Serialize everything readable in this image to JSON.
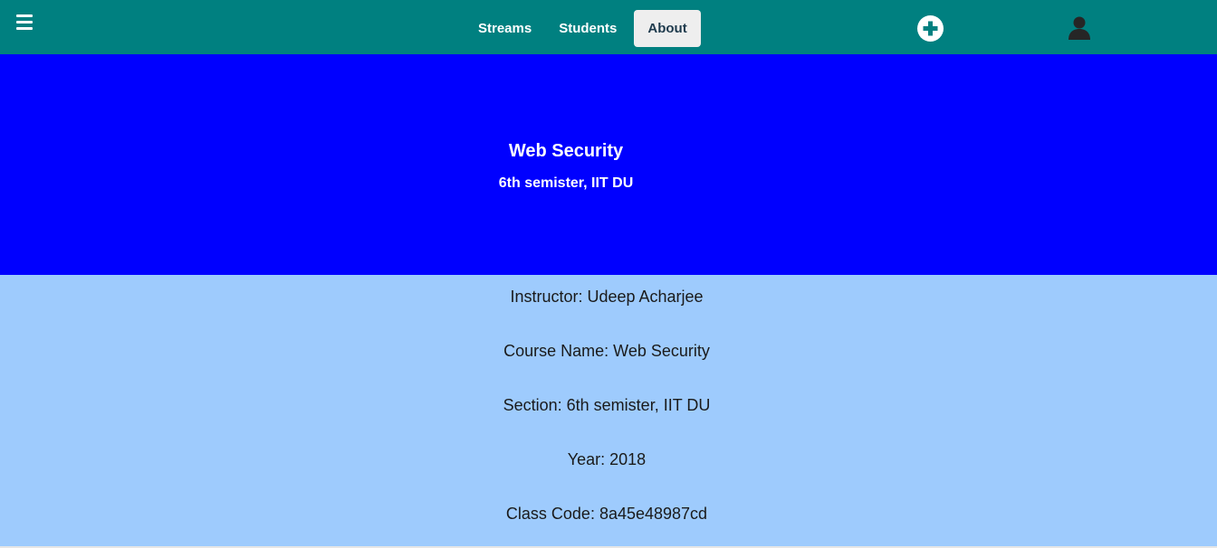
{
  "colors": {
    "topbar": "#008080",
    "hero": "#0000ff",
    "info_bg": "#9ecbfd",
    "active_tab_bg": "#eeeeee"
  },
  "topbar": {
    "menu_icon": "hamburger-menu-icon",
    "tabs": [
      {
        "label": "Streams",
        "active": false
      },
      {
        "label": "Students",
        "active": false
      },
      {
        "label": "About",
        "active": true
      }
    ],
    "add_icon": "plus-circle-icon",
    "user_icon": "user-icon"
  },
  "hero": {
    "title": "Web Security",
    "subtitle": "6th semister, IIT DU"
  },
  "info": {
    "instructor": "Instructor: Udeep Acharjee",
    "course_name": "Course Name: Web Security",
    "section": "Section: 6th semister, IIT DU",
    "year": "Year: 2018",
    "class_code": "Class Code: 8a45e48987cd"
  }
}
